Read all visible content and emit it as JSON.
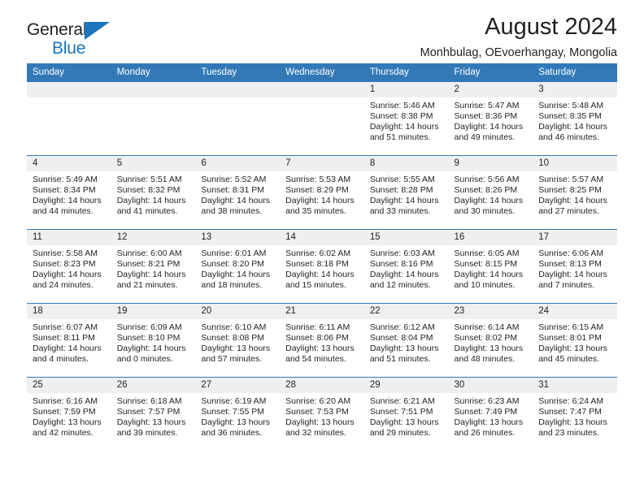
{
  "brand": {
    "name_top": "General",
    "name_bottom": "Blue",
    "triangle_color": "#1b75bb"
  },
  "header": {
    "title": "August 2024",
    "subtitle": "Monhbulag, OEvoerhangay, Mongolia"
  },
  "theme": {
    "header_row_bg": "#3379b7",
    "day_number_bg": "#efefef",
    "text_color": "#231f20",
    "accent": "#1b75bb"
  },
  "weekday_headers": [
    "Sunday",
    "Monday",
    "Tuesday",
    "Wednesday",
    "Thursday",
    "Friday",
    "Saturday"
  ],
  "weeks": [
    [
      {
        "day": "",
        "sunrise": "",
        "sunset": "",
        "daylight_line1": "",
        "daylight_line2": "",
        "empty": true
      },
      {
        "day": "",
        "sunrise": "",
        "sunset": "",
        "daylight_line1": "",
        "daylight_line2": "",
        "empty": true
      },
      {
        "day": "",
        "sunrise": "",
        "sunset": "",
        "daylight_line1": "",
        "daylight_line2": "",
        "empty": true
      },
      {
        "day": "",
        "sunrise": "",
        "sunset": "",
        "daylight_line1": "",
        "daylight_line2": "",
        "empty": true
      },
      {
        "day": "1",
        "sunrise": "Sunrise: 5:46 AM",
        "sunset": "Sunset: 8:38 PM",
        "daylight_line1": "Daylight: 14 hours",
        "daylight_line2": "and 51 minutes."
      },
      {
        "day": "2",
        "sunrise": "Sunrise: 5:47 AM",
        "sunset": "Sunset: 8:36 PM",
        "daylight_line1": "Daylight: 14 hours",
        "daylight_line2": "and 49 minutes."
      },
      {
        "day": "3",
        "sunrise": "Sunrise: 5:48 AM",
        "sunset": "Sunset: 8:35 PM",
        "daylight_line1": "Daylight: 14 hours",
        "daylight_line2": "and 46 minutes."
      }
    ],
    [
      {
        "day": "4",
        "sunrise": "Sunrise: 5:49 AM",
        "sunset": "Sunset: 8:34 PM",
        "daylight_line1": "Daylight: 14 hours",
        "daylight_line2": "and 44 minutes."
      },
      {
        "day": "5",
        "sunrise": "Sunrise: 5:51 AM",
        "sunset": "Sunset: 8:32 PM",
        "daylight_line1": "Daylight: 14 hours",
        "daylight_line2": "and 41 minutes."
      },
      {
        "day": "6",
        "sunrise": "Sunrise: 5:52 AM",
        "sunset": "Sunset: 8:31 PM",
        "daylight_line1": "Daylight: 14 hours",
        "daylight_line2": "and 38 minutes."
      },
      {
        "day": "7",
        "sunrise": "Sunrise: 5:53 AM",
        "sunset": "Sunset: 8:29 PM",
        "daylight_line1": "Daylight: 14 hours",
        "daylight_line2": "and 35 minutes."
      },
      {
        "day": "8",
        "sunrise": "Sunrise: 5:55 AM",
        "sunset": "Sunset: 8:28 PM",
        "daylight_line1": "Daylight: 14 hours",
        "daylight_line2": "and 33 minutes."
      },
      {
        "day": "9",
        "sunrise": "Sunrise: 5:56 AM",
        "sunset": "Sunset: 8:26 PM",
        "daylight_line1": "Daylight: 14 hours",
        "daylight_line2": "and 30 minutes."
      },
      {
        "day": "10",
        "sunrise": "Sunrise: 5:57 AM",
        "sunset": "Sunset: 8:25 PM",
        "daylight_line1": "Daylight: 14 hours",
        "daylight_line2": "and 27 minutes."
      }
    ],
    [
      {
        "day": "11",
        "sunrise": "Sunrise: 5:58 AM",
        "sunset": "Sunset: 8:23 PM",
        "daylight_line1": "Daylight: 14 hours",
        "daylight_line2": "and 24 minutes."
      },
      {
        "day": "12",
        "sunrise": "Sunrise: 6:00 AM",
        "sunset": "Sunset: 8:21 PM",
        "daylight_line1": "Daylight: 14 hours",
        "daylight_line2": "and 21 minutes."
      },
      {
        "day": "13",
        "sunrise": "Sunrise: 6:01 AM",
        "sunset": "Sunset: 8:20 PM",
        "daylight_line1": "Daylight: 14 hours",
        "daylight_line2": "and 18 minutes."
      },
      {
        "day": "14",
        "sunrise": "Sunrise: 6:02 AM",
        "sunset": "Sunset: 8:18 PM",
        "daylight_line1": "Daylight: 14 hours",
        "daylight_line2": "and 15 minutes."
      },
      {
        "day": "15",
        "sunrise": "Sunrise: 6:03 AM",
        "sunset": "Sunset: 8:16 PM",
        "daylight_line1": "Daylight: 14 hours",
        "daylight_line2": "and 12 minutes."
      },
      {
        "day": "16",
        "sunrise": "Sunrise: 6:05 AM",
        "sunset": "Sunset: 8:15 PM",
        "daylight_line1": "Daylight: 14 hours",
        "daylight_line2": "and 10 minutes."
      },
      {
        "day": "17",
        "sunrise": "Sunrise: 6:06 AM",
        "sunset": "Sunset: 8:13 PM",
        "daylight_line1": "Daylight: 14 hours",
        "daylight_line2": "and 7 minutes."
      }
    ],
    [
      {
        "day": "18",
        "sunrise": "Sunrise: 6:07 AM",
        "sunset": "Sunset: 8:11 PM",
        "daylight_line1": "Daylight: 14 hours",
        "daylight_line2": "and 4 minutes."
      },
      {
        "day": "19",
        "sunrise": "Sunrise: 6:09 AM",
        "sunset": "Sunset: 8:10 PM",
        "daylight_line1": "Daylight: 14 hours",
        "daylight_line2": "and 0 minutes."
      },
      {
        "day": "20",
        "sunrise": "Sunrise: 6:10 AM",
        "sunset": "Sunset: 8:08 PM",
        "daylight_line1": "Daylight: 13 hours",
        "daylight_line2": "and 57 minutes."
      },
      {
        "day": "21",
        "sunrise": "Sunrise: 6:11 AM",
        "sunset": "Sunset: 8:06 PM",
        "daylight_line1": "Daylight: 13 hours",
        "daylight_line2": "and 54 minutes."
      },
      {
        "day": "22",
        "sunrise": "Sunrise: 6:12 AM",
        "sunset": "Sunset: 8:04 PM",
        "daylight_line1": "Daylight: 13 hours",
        "daylight_line2": "and 51 minutes."
      },
      {
        "day": "23",
        "sunrise": "Sunrise: 6:14 AM",
        "sunset": "Sunset: 8:02 PM",
        "daylight_line1": "Daylight: 13 hours",
        "daylight_line2": "and 48 minutes."
      },
      {
        "day": "24",
        "sunrise": "Sunrise: 6:15 AM",
        "sunset": "Sunset: 8:01 PM",
        "daylight_line1": "Daylight: 13 hours",
        "daylight_line2": "and 45 minutes."
      }
    ],
    [
      {
        "day": "25",
        "sunrise": "Sunrise: 6:16 AM",
        "sunset": "Sunset: 7:59 PM",
        "daylight_line1": "Daylight: 13 hours",
        "daylight_line2": "and 42 minutes."
      },
      {
        "day": "26",
        "sunrise": "Sunrise: 6:18 AM",
        "sunset": "Sunset: 7:57 PM",
        "daylight_line1": "Daylight: 13 hours",
        "daylight_line2": "and 39 minutes."
      },
      {
        "day": "27",
        "sunrise": "Sunrise: 6:19 AM",
        "sunset": "Sunset: 7:55 PM",
        "daylight_line1": "Daylight: 13 hours",
        "daylight_line2": "and 36 minutes."
      },
      {
        "day": "28",
        "sunrise": "Sunrise: 6:20 AM",
        "sunset": "Sunset: 7:53 PM",
        "daylight_line1": "Daylight: 13 hours",
        "daylight_line2": "and 32 minutes."
      },
      {
        "day": "29",
        "sunrise": "Sunrise: 6:21 AM",
        "sunset": "Sunset: 7:51 PM",
        "daylight_line1": "Daylight: 13 hours",
        "daylight_line2": "and 29 minutes."
      },
      {
        "day": "30",
        "sunrise": "Sunrise: 6:23 AM",
        "sunset": "Sunset: 7:49 PM",
        "daylight_line1": "Daylight: 13 hours",
        "daylight_line2": "and 26 minutes."
      },
      {
        "day": "31",
        "sunrise": "Sunrise: 6:24 AM",
        "sunset": "Sunset: 7:47 PM",
        "daylight_line1": "Daylight: 13 hours",
        "daylight_line2": "and 23 minutes."
      }
    ]
  ]
}
